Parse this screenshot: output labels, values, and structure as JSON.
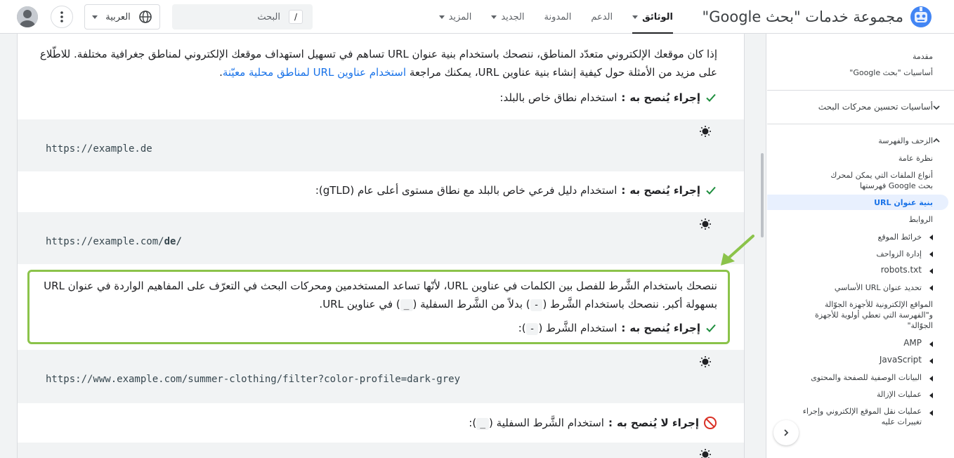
{
  "header": {
    "brand_title": "مجموعة خدمات \"بحث Google\"",
    "nav": [
      {
        "label": "الوثائق",
        "active": true,
        "dropdown": true
      },
      {
        "label": "الدعم",
        "active": false,
        "dropdown": false
      },
      {
        "label": "المدونة",
        "active": false,
        "dropdown": false
      },
      {
        "label": "الجديد",
        "active": false,
        "dropdown": true
      },
      {
        "label": "المزيد",
        "active": false,
        "dropdown": true
      }
    ],
    "search_placeholder": "البحث",
    "search_shortcut": "/",
    "language": "العربية"
  },
  "sidebar": {
    "intro_label": "مقدمة",
    "intro_item": "أساسيات \"بحث Google\"",
    "seo_label": "أساسيات تحسين محركات البحث",
    "crawl_label": "الزحف والفهرسة",
    "items": [
      "نظرة عامة",
      "أنواع الملفات التي يمكن لمحرك بحث Google فهرستها",
      "بنية عنوان URL",
      "الروابط",
      "خرائط الموقع",
      "إدارة الزواحف",
      "robots.txt",
      "تحديد عنوان URL الأساسي",
      "المواقع الإلكترونية للأجهزة الجوّالة و\"الفهرسة التي تعطي أولوية للأجهزة الجوّالة\"",
      "AMP",
      "JavaScript",
      "البيانات الوصفية للصفحة والمحتوى",
      "عمليات الإزالة",
      "عمليات نقل الموقع الإلكتروني وإجراء تغييرات عليه"
    ]
  },
  "content": {
    "para1_a": "إذا كان موقعك الإلكتروني متعدّد المناطق، ننصحك باستخدام بنية عنوان URL تساهم في تسهيل استهداف موقعك الإلكتروني لمناطق جغرافية مختلفة. للاطّلاع على مزيد من الأمثلة حول كيفية إنشاء بنية عناوين URL، يمكنك مراجعة",
    "para1_link": "استخدام عناوين URL لمناطق محلية معيّنة",
    "rec_label": "إجراء يُنصح به",
    "not_rec_label": "إجراء لا يُنصح به",
    "rec1_text": "استخدام نطاق خاص بالبلد:",
    "code1": "https://example.de",
    "rec2_text": "استخدام دليل فرعي خاص بالبلد مع نطاق مستوى أعلى عام (gTLD):",
    "code2_prefix": "https://example.com/",
    "code2_bold": "de/",
    "para2_a": "ننصحك باستخدام الشَّرط للفصل بين الكلمات في عناوين URL، لأنّها تساعد المستخدمين ومحركات البحث في التعرّف على المفاهيم الواردة في عنوان URL بسهولة أكبر. ننصحك باستخدام الشَّرط (",
    "hyphen_chip": "-",
    "para2_b": ") بدلاً من الشَّرط السفلية (",
    "underscore_chip": "_",
    "para2_c": ") في عناوين URL.",
    "rec3_text": "استخدام الشَّرط (",
    "rec3_end": "):",
    "code3": "https://www.example.com/summer-clothing/filter?color-profile=dark-grey",
    "notrec_text": "استخدام الشَّرط السفلية (",
    "notrec_end": "):"
  },
  "colors": {
    "accent_green": "#1e8e3e",
    "link_blue": "#1a73e8",
    "highlight_green": "#8bc34a",
    "not_rec_red": "#d93025"
  }
}
